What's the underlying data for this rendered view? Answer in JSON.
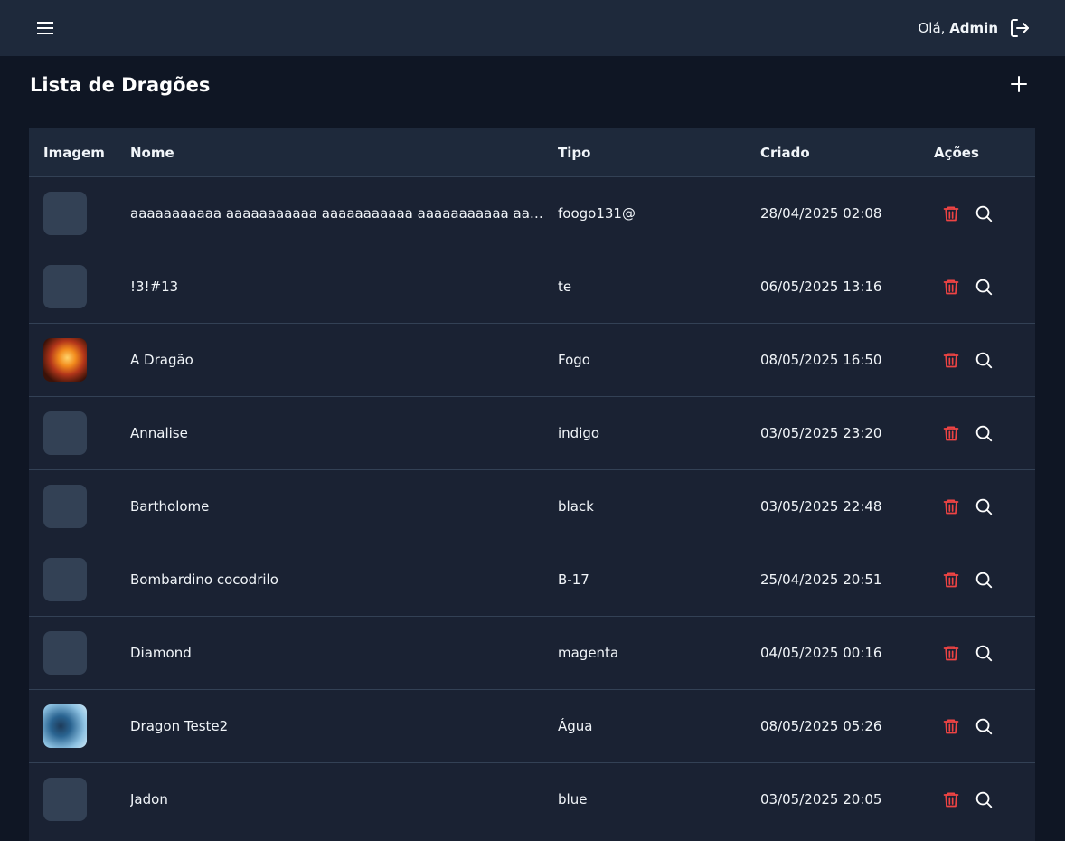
{
  "header": {
    "greeting_prefix": "Olá,",
    "user_name": "Admin",
    "menu_icon": "hamburger-menu-icon",
    "logout_icon": "logout-icon"
  },
  "page": {
    "title": "Lista de Dragões",
    "add_icon": "plus-icon"
  },
  "table": {
    "columns": [
      "Imagem",
      "Nome",
      "Tipo",
      "Criado",
      "Ações"
    ],
    "rows": [
      {
        "image": "placeholder",
        "nome": "aaaaaaaaaaa aaaaaaaaaaa aaaaaaaaaaa aaaaaaaaaaa aaaaaaaaaaa",
        "tipo": "foogo131@",
        "criado": "28/04/2025 02:08"
      },
      {
        "image": "placeholder",
        "nome": "!3!#13",
        "tipo": "te",
        "criado": "06/05/2025 13:16"
      },
      {
        "image": "fire-dragon",
        "nome": "A Dragão",
        "tipo": "Fogo",
        "criado": "08/05/2025 16:50"
      },
      {
        "image": "placeholder",
        "nome": "Annalise",
        "tipo": "indigo",
        "criado": "03/05/2025 23:20"
      },
      {
        "image": "placeholder",
        "nome": "Bartholome",
        "tipo": "black",
        "criado": "03/05/2025 22:48"
      },
      {
        "image": "placeholder",
        "nome": "Bombardino cocodrilo",
        "tipo": "B-17",
        "criado": "25/04/2025 20:51"
      },
      {
        "image": "placeholder",
        "nome": "Diamond",
        "tipo": "magenta",
        "criado": "04/05/2025 00:16"
      },
      {
        "image": "water-dragon",
        "nome": "Dragon Teste2",
        "tipo": "Água",
        "criado": "08/05/2025 05:26"
      },
      {
        "image": "placeholder",
        "nome": "Jadon",
        "tipo": "blue",
        "criado": "03/05/2025 20:05"
      }
    ],
    "action_icons": [
      "trash-icon",
      "search-icon"
    ]
  },
  "colors": {
    "background": "#0f1624",
    "topbar": "#1e293b",
    "table_body": "#1a2233",
    "delete_red": "#ef4444",
    "text": "#f1f5f9"
  }
}
